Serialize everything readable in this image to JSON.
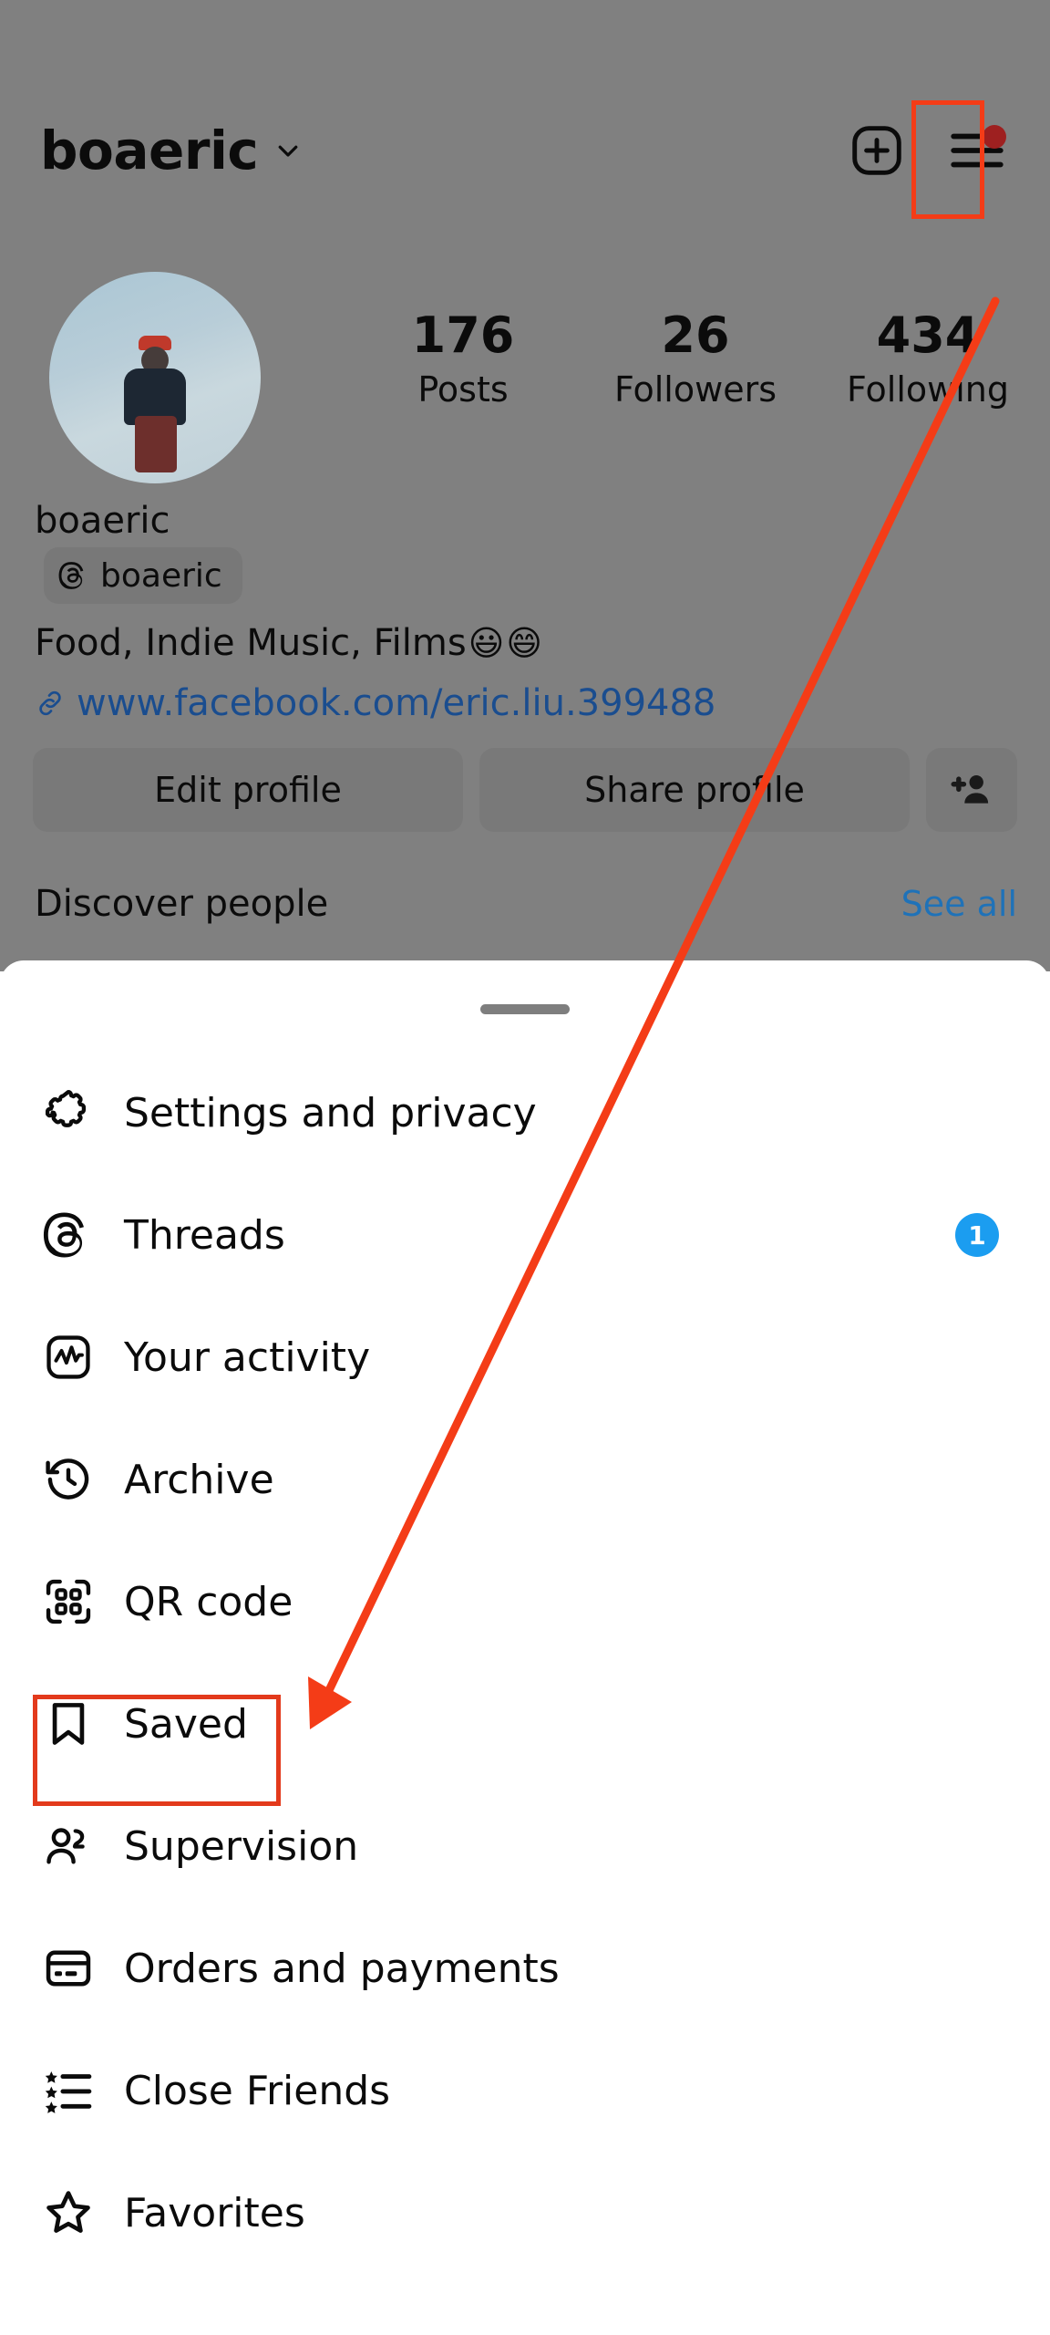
{
  "header": {
    "username": "boaeric",
    "chevron_icon": "chevron-down-icon",
    "new_post_icon": "plus-square-icon",
    "menu_icon": "hamburger-menu-icon",
    "menu_has_notification": true,
    "notification_dot_color": "#9e2020"
  },
  "profile": {
    "avatar_alt": "profile-photo",
    "display_name": "boaeric",
    "threads_handle": "boaeric",
    "threads_icon": "threads-icon",
    "bio": "Food, Indie Music, Films",
    "bio_emoji_1": "😃",
    "bio_emoji_2": "😄",
    "link_icon": "link-icon",
    "link": "www.facebook.com/eric.liu.399488",
    "link_color": "#1a4d8f",
    "stats": [
      {
        "value": "176",
        "label": "Posts"
      },
      {
        "value": "26",
        "label": "Followers"
      },
      {
        "value": "434",
        "label": "Following"
      }
    ],
    "actions": {
      "edit_profile": "Edit profile",
      "share_profile": "Share profile",
      "add_person_icon": "add-person-icon"
    },
    "discover": {
      "label": "Discover people",
      "see_all": "See all",
      "see_all_color": "#1f72b8"
    }
  },
  "sheet": {
    "handle": "drag-handle",
    "menu_items": [
      {
        "label": "Settings and privacy",
        "icon": "gear-icon",
        "badge": null
      },
      {
        "label": "Threads",
        "icon": "threads-icon",
        "badge": "1"
      },
      {
        "label": "Your activity",
        "icon": "activity-icon",
        "badge": null
      },
      {
        "label": "Archive",
        "icon": "archive-clock-icon",
        "badge": null
      },
      {
        "label": "QR code",
        "icon": "qr-code-icon",
        "badge": null
      },
      {
        "label": "Saved",
        "icon": "bookmark-icon",
        "badge": null
      },
      {
        "label": "Supervision",
        "icon": "supervision-people-icon",
        "badge": null
      },
      {
        "label": "Orders and payments",
        "icon": "credit-card-icon",
        "badge": null
      },
      {
        "label": "Close Friends",
        "icon": "star-list-icon",
        "badge": null
      },
      {
        "label": "Favorites",
        "icon": "star-icon",
        "badge": null
      }
    ],
    "badge_color": "#1b9df0"
  },
  "annotations": {
    "highlight_color": "#f43c17",
    "boxes": [
      {
        "target": "hamburger-menu-icon"
      },
      {
        "target": "menu-item-saved"
      }
    ],
    "arrow": {
      "from": "hamburger-menu-icon",
      "to": "menu-item-saved"
    }
  }
}
